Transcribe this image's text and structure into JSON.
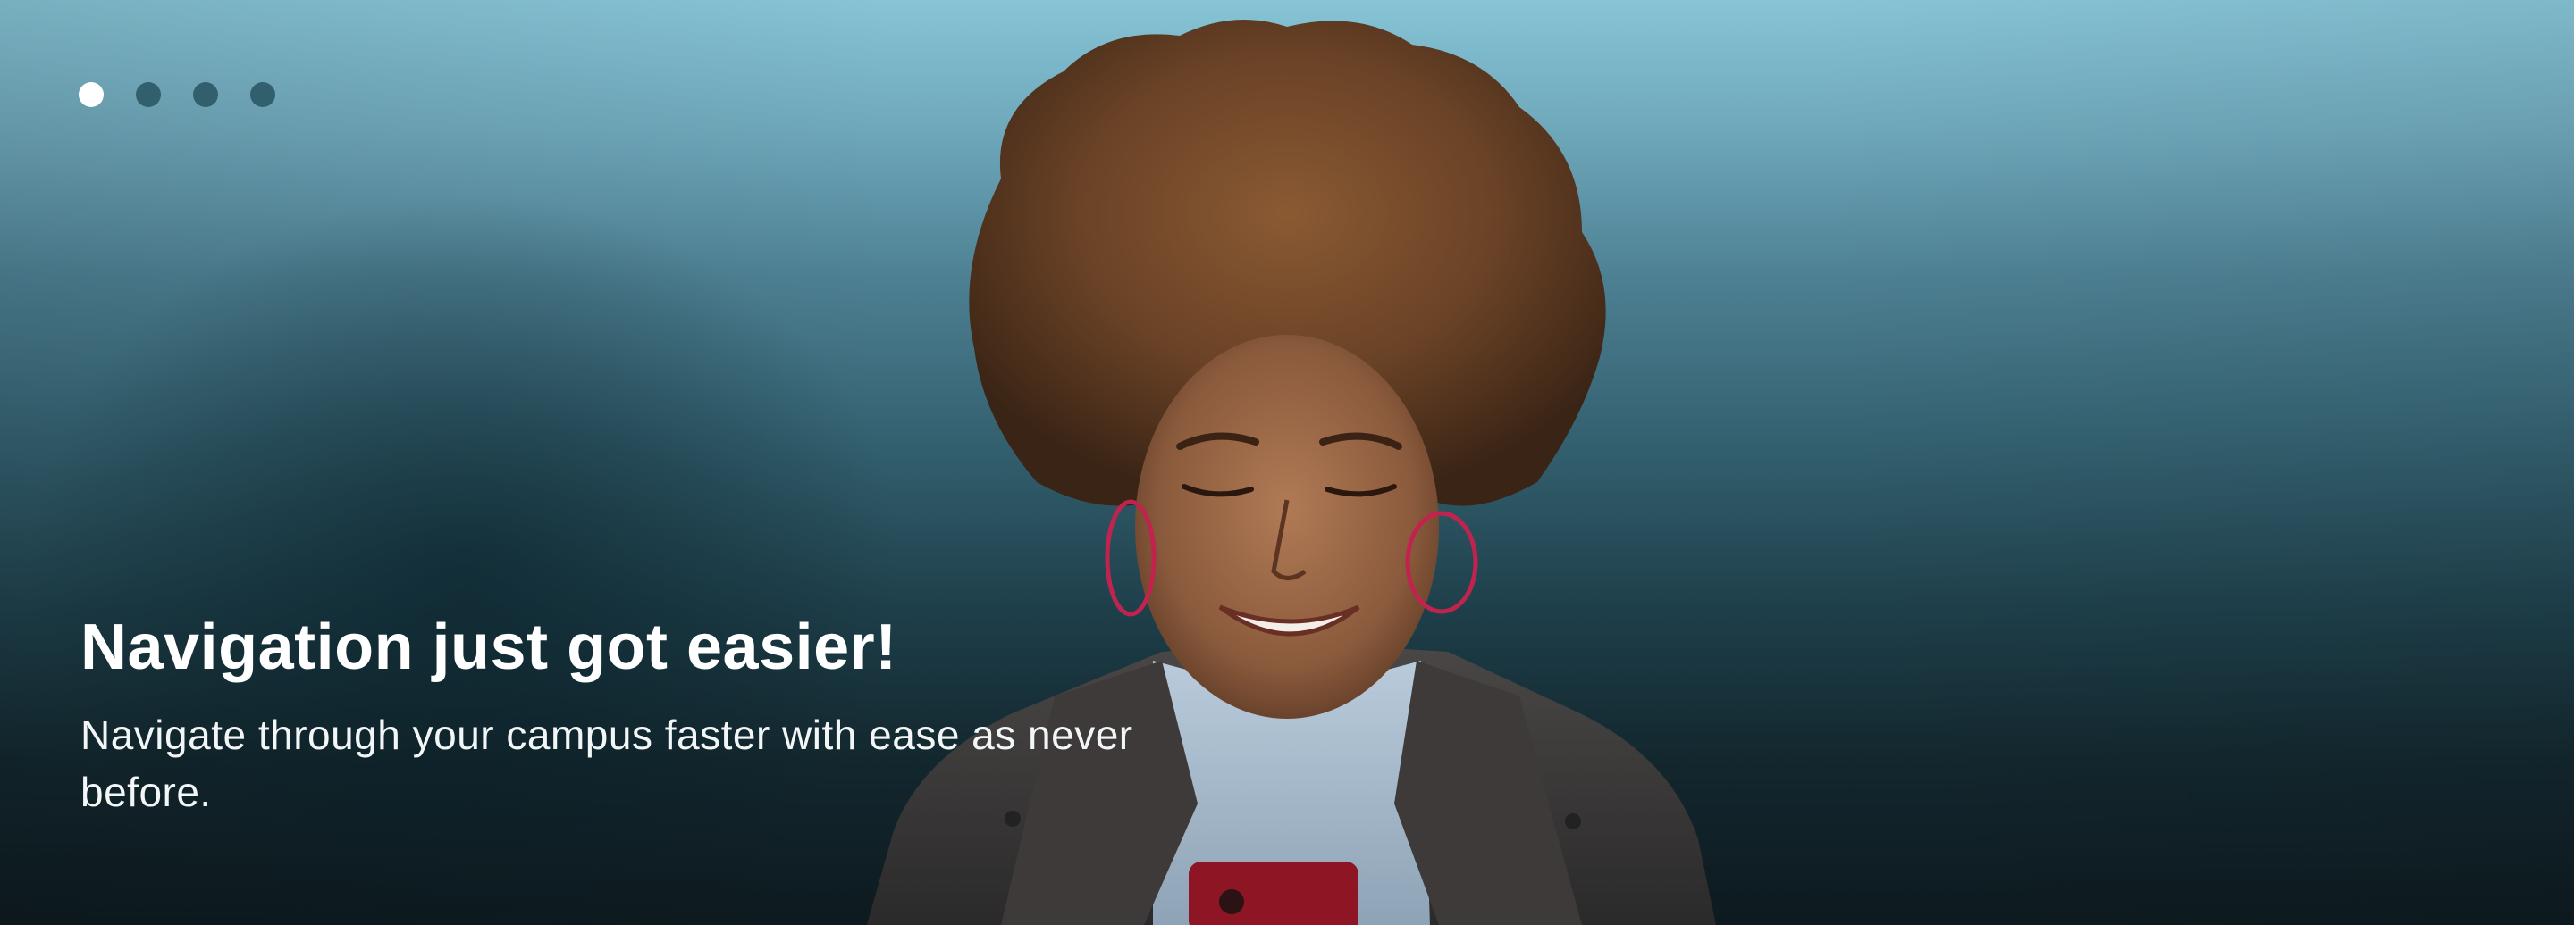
{
  "carousel": {
    "slide_count": 4,
    "active_slide": 1,
    "dots": [
      {
        "label": "slide-1",
        "active": true
      },
      {
        "label": "slide-2",
        "active": false
      },
      {
        "label": "slide-3",
        "active": false
      },
      {
        "label": "slide-4",
        "active": false
      }
    ]
  },
  "slide": {
    "headline": "Navigation just got easier!",
    "subheadline": "Navigate through your campus faster with ease as never before."
  },
  "colors": {
    "background_top": "#86c4d6",
    "background_bottom": "#0d1a1f",
    "dot_active": "#ffffff",
    "dot_inactive": "#285460",
    "text": "#ffffff",
    "earring": "#c0244e",
    "phone": "#8e1523"
  }
}
